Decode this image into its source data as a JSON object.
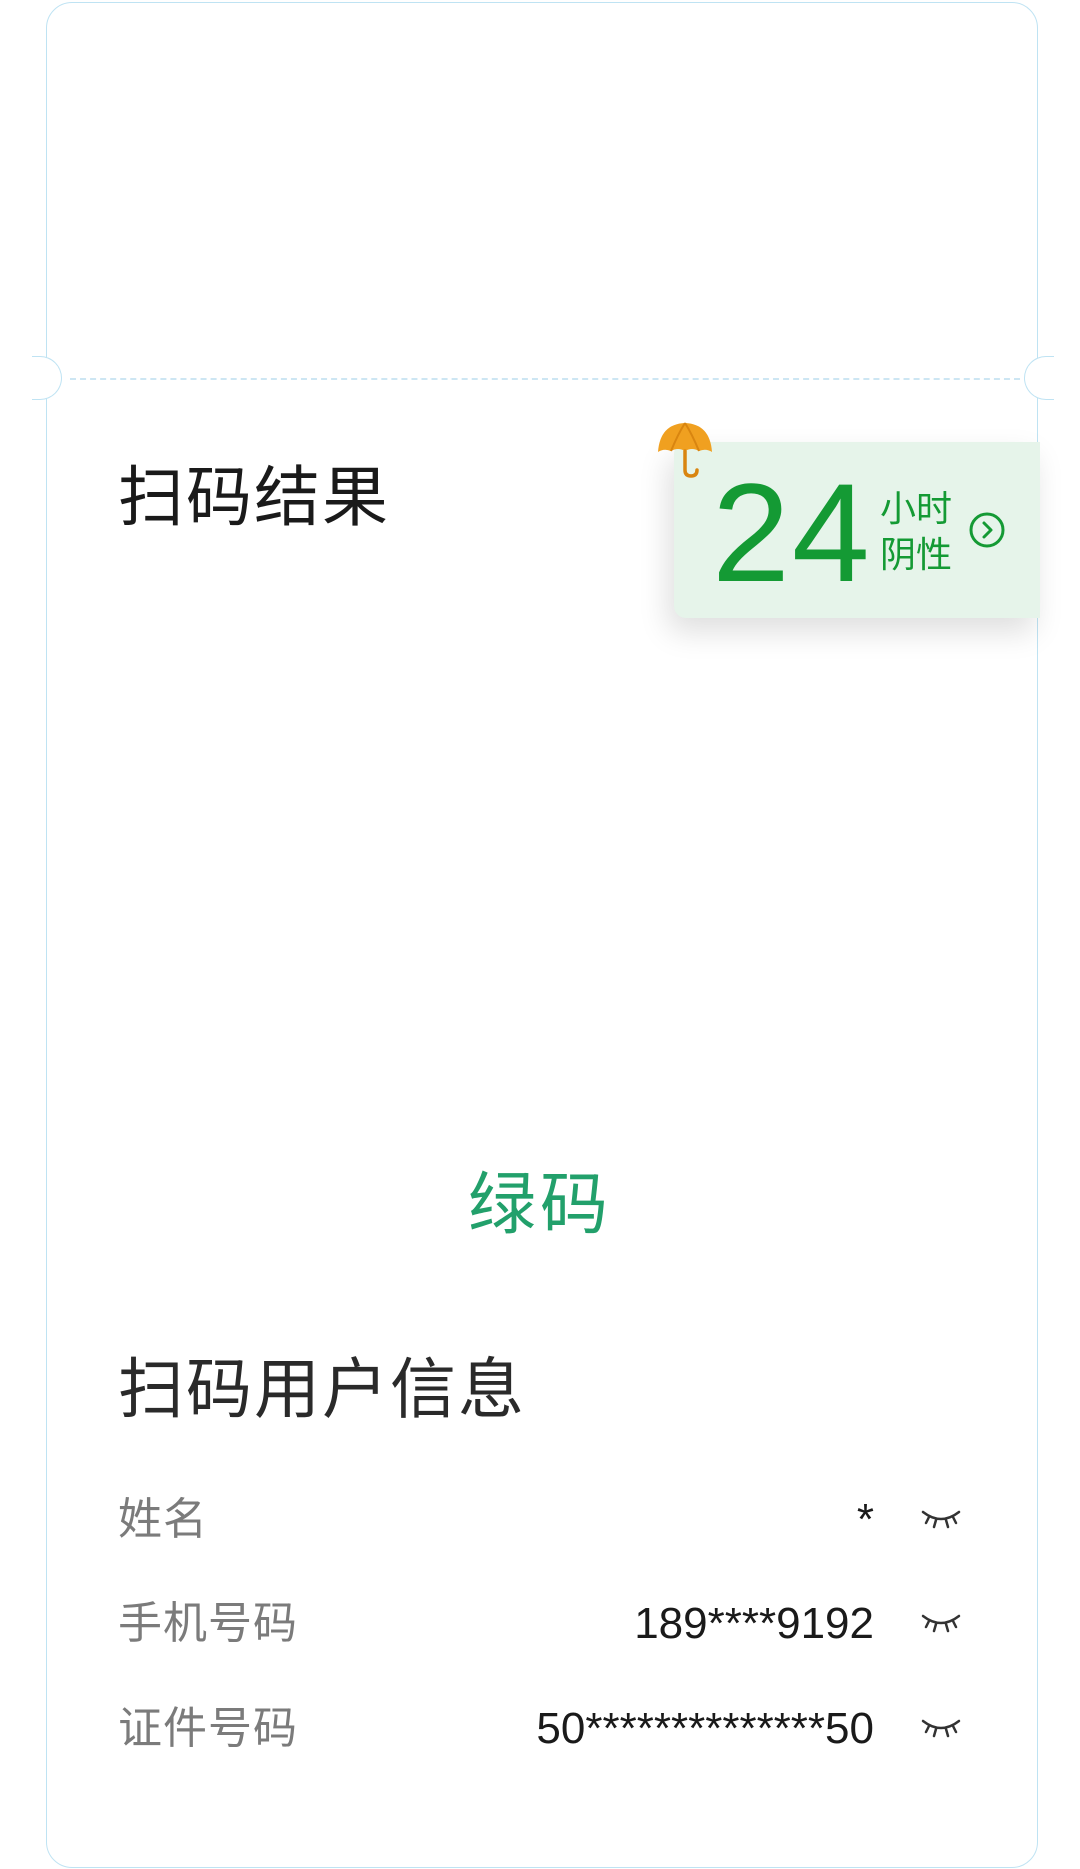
{
  "scan_result": {
    "title": "扫码结果",
    "negative_badge": {
      "hours": "24",
      "unit_line1": "小时",
      "unit_line2": "阴性",
      "icon": "umbrella-icon",
      "arrow_icon": "chevron-right-circle-icon",
      "accent_color": "#149a34",
      "background_color": "#e6f4ea"
    },
    "code_status": "绿码",
    "code_status_color": "#22a06b"
  },
  "user_info": {
    "title": "扫码用户信息",
    "rows": [
      {
        "label": "姓名",
        "value": "*",
        "toggle_icon": "eye-closed-icon"
      },
      {
        "label": "手机号码",
        "value": "189****9192",
        "toggle_icon": "eye-closed-icon"
      },
      {
        "label": "证件号码",
        "value": "50**************50",
        "toggle_icon": "eye-closed-icon"
      }
    ]
  }
}
